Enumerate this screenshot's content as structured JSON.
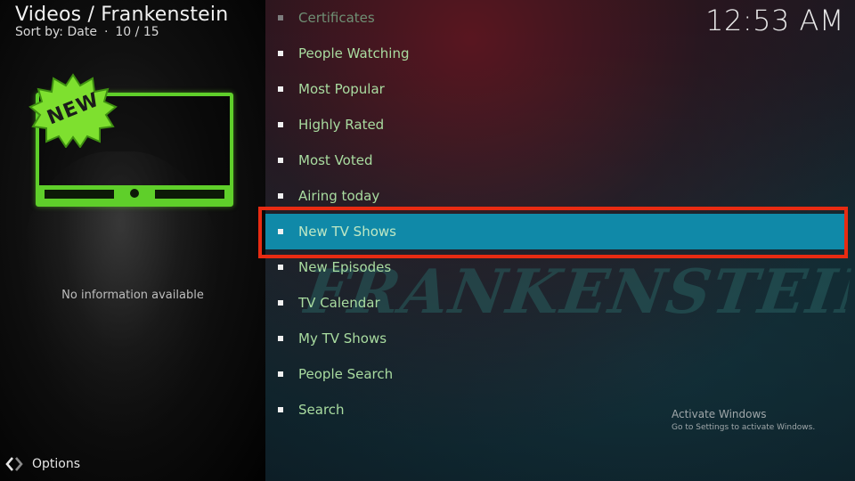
{
  "header": {
    "breadcrumb": "Videos / Frankenstein",
    "sort_label": "Sort by: Date",
    "position": "10 / 15"
  },
  "clock": "12:53 AM",
  "thumbnail": {
    "badge_text": "NEW",
    "badge_color": "#7ee02f",
    "frame_color": "#5fcf2a"
  },
  "info": {
    "no_info_text": "No information available"
  },
  "options": {
    "label": "Options",
    "icon": "options-chevrons-icon"
  },
  "background": {
    "watermark_text": "FRANKENSTEIN"
  },
  "menu": {
    "items": [
      {
        "label": "Certificates",
        "state": "dim"
      },
      {
        "label": "People Watching",
        "state": "normal"
      },
      {
        "label": "Most Popular",
        "state": "normal"
      },
      {
        "label": "Highly Rated",
        "state": "normal"
      },
      {
        "label": "Most Voted",
        "state": "normal"
      },
      {
        "label": "Airing today",
        "state": "normal"
      },
      {
        "label": "New TV Shows",
        "state": "selected"
      },
      {
        "label": "New Episodes",
        "state": "normal"
      },
      {
        "label": "TV Calendar",
        "state": "normal"
      },
      {
        "label": "My TV Shows",
        "state": "normal"
      },
      {
        "label": "People Search",
        "state": "normal"
      },
      {
        "label": "Search",
        "state": "normal"
      }
    ],
    "selected_color": "#1089a8",
    "highlight_outline_color": "#e82b12"
  },
  "system_notice": {
    "title": "Activate Windows",
    "subtitle": "Go to Settings to activate Windows."
  }
}
